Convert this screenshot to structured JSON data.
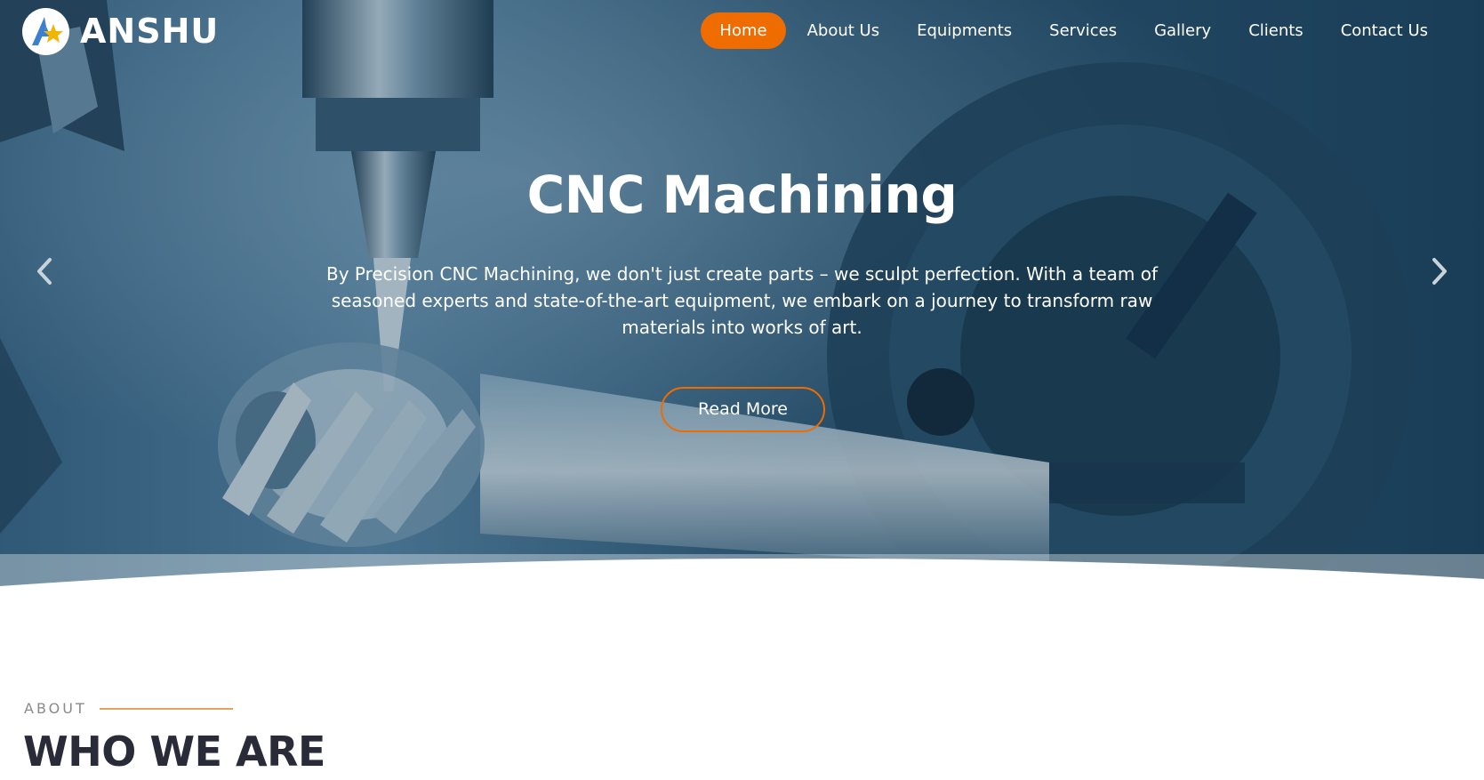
{
  "brand": {
    "name": "ANSHU",
    "accent_color": "#ef6c00"
  },
  "nav": {
    "items": [
      {
        "label": "Home",
        "active": true
      },
      {
        "label": "About Us",
        "active": false
      },
      {
        "label": "Equipments",
        "active": false
      },
      {
        "label": "Services",
        "active": false
      },
      {
        "label": "Gallery",
        "active": false
      },
      {
        "label": "Clients",
        "active": false
      },
      {
        "label": "Contact Us",
        "active": false
      }
    ]
  },
  "hero": {
    "title": "CNC Machining",
    "description": "By Precision CNC Machining, we don't just create parts – we sculpt perfection. With a team of seasoned experts and state-of-the-art equipment, we embark on a journey to transform raw materials into works of art.",
    "button_label": "Read More",
    "prev_icon": "chevron-left-icon",
    "next_icon": "chevron-right-icon"
  },
  "about": {
    "label": "ABOUT",
    "heading": "WHO WE ARE"
  }
}
